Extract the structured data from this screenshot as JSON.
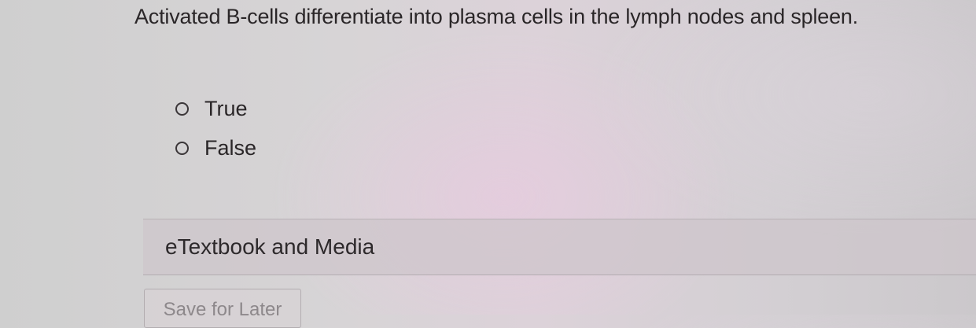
{
  "question": {
    "text": "Activated B-cells differentiate into plasma cells in the lymph nodes and spleen."
  },
  "options": [
    {
      "label": "True",
      "selected": false
    },
    {
      "label": "False",
      "selected": false
    }
  ],
  "resources": {
    "etextbook_label": "eTextbook and Media"
  },
  "actions": {
    "save_label": "Save for Later"
  }
}
